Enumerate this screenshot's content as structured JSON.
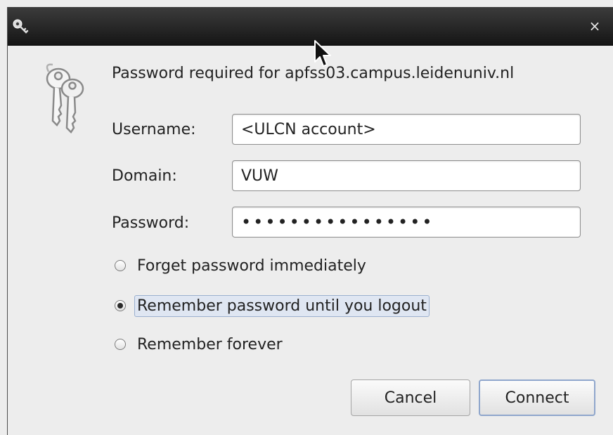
{
  "dialog": {
    "title_icon": "key-icon",
    "close_glyph": "×",
    "keys_icon": "keys-icon",
    "message": "Password required for apfss03.campus.leidenuniv.nl"
  },
  "form": {
    "username": {
      "label": "Username:",
      "value": "<ULCN account>"
    },
    "domain": {
      "label": "Domain:",
      "value": "VUW"
    },
    "password": {
      "label": "Password:",
      "value": "••••••••••••••••"
    }
  },
  "options": [
    {
      "label": "Forget password immediately",
      "checked": false
    },
    {
      "label": "Remember password until you logout",
      "checked": true
    },
    {
      "label": "Remember forever",
      "checked": false
    }
  ],
  "buttons": {
    "cancel": "Cancel",
    "connect": "Connect"
  }
}
